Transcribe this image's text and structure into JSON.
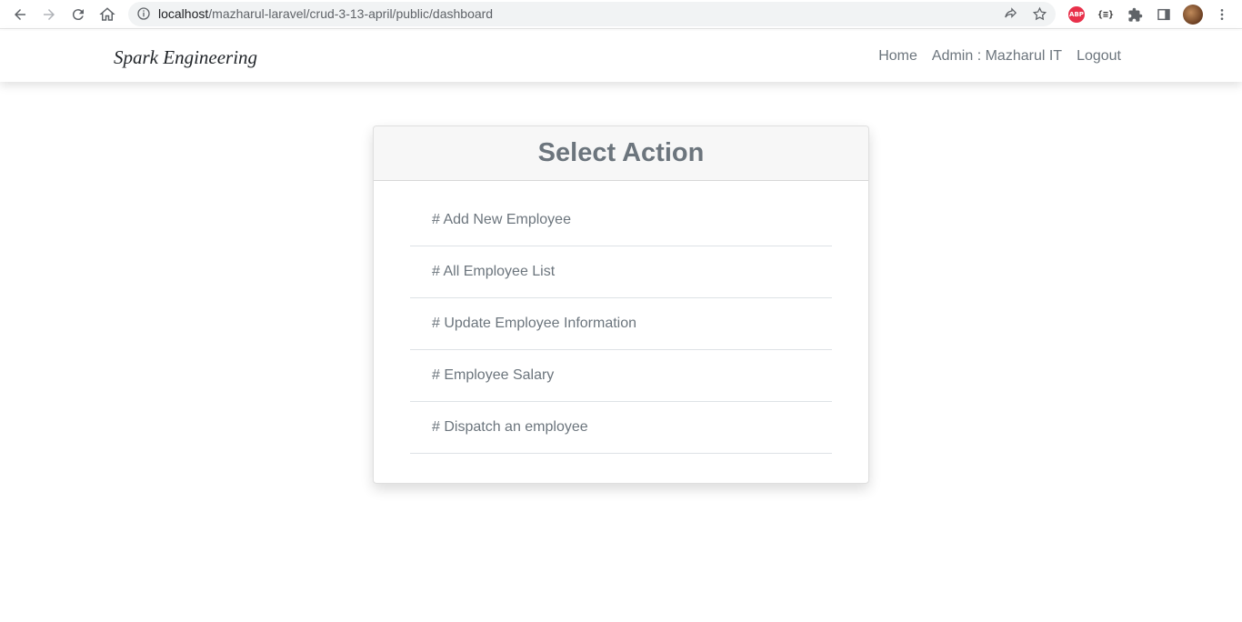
{
  "browser": {
    "url_host": "localhost",
    "url_path": "/mazharul-laravel/crud-3-13-april/public/dashboard",
    "abp_label": "ABP",
    "json_ext_label": "{≡}"
  },
  "navbar": {
    "brand": "Spark Engineering",
    "links": [
      "Home",
      "Admin : Mazharul IT",
      "Logout"
    ]
  },
  "card": {
    "title": "Select Action",
    "items": [
      "# Add New Employee",
      "# All Employee List",
      "# Update Employee Information",
      "# Employee Salary",
      "# Dispatch an employee"
    ]
  }
}
